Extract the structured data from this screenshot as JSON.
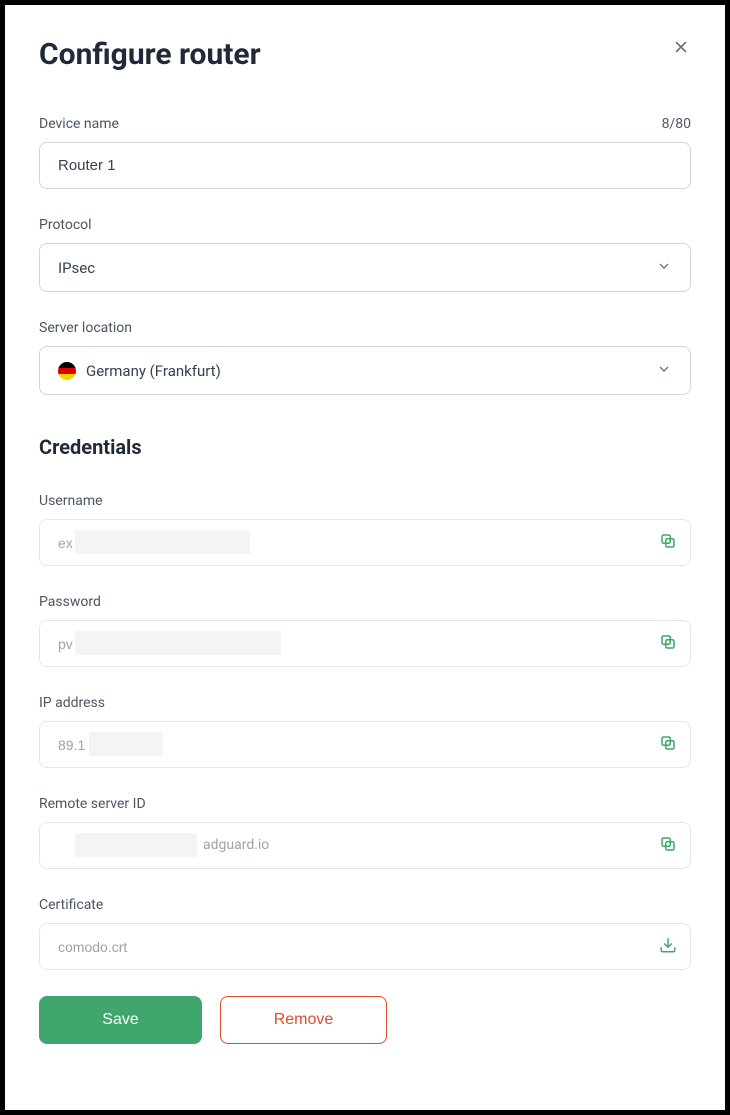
{
  "title": "Configure router",
  "device_name": {
    "label": "Device name",
    "value": "Router 1",
    "counter": "8/80"
  },
  "protocol": {
    "label": "Protocol",
    "value": "IPsec"
  },
  "server_location": {
    "label": "Server location",
    "value": "Germany (Frankfurt)"
  },
  "credentials_title": "Credentials",
  "username": {
    "label": "Username",
    "value": "ex"
  },
  "password": {
    "label": "Password",
    "value": "pv"
  },
  "ip_address": {
    "label": "IP address",
    "value": "89.1"
  },
  "remote_server_id": {
    "label": "Remote server ID",
    "suffix": "adguard.io"
  },
  "certificate": {
    "label": "Certificate",
    "value": "comodo.crt"
  },
  "buttons": {
    "save": "Save",
    "remove": "Remove"
  }
}
